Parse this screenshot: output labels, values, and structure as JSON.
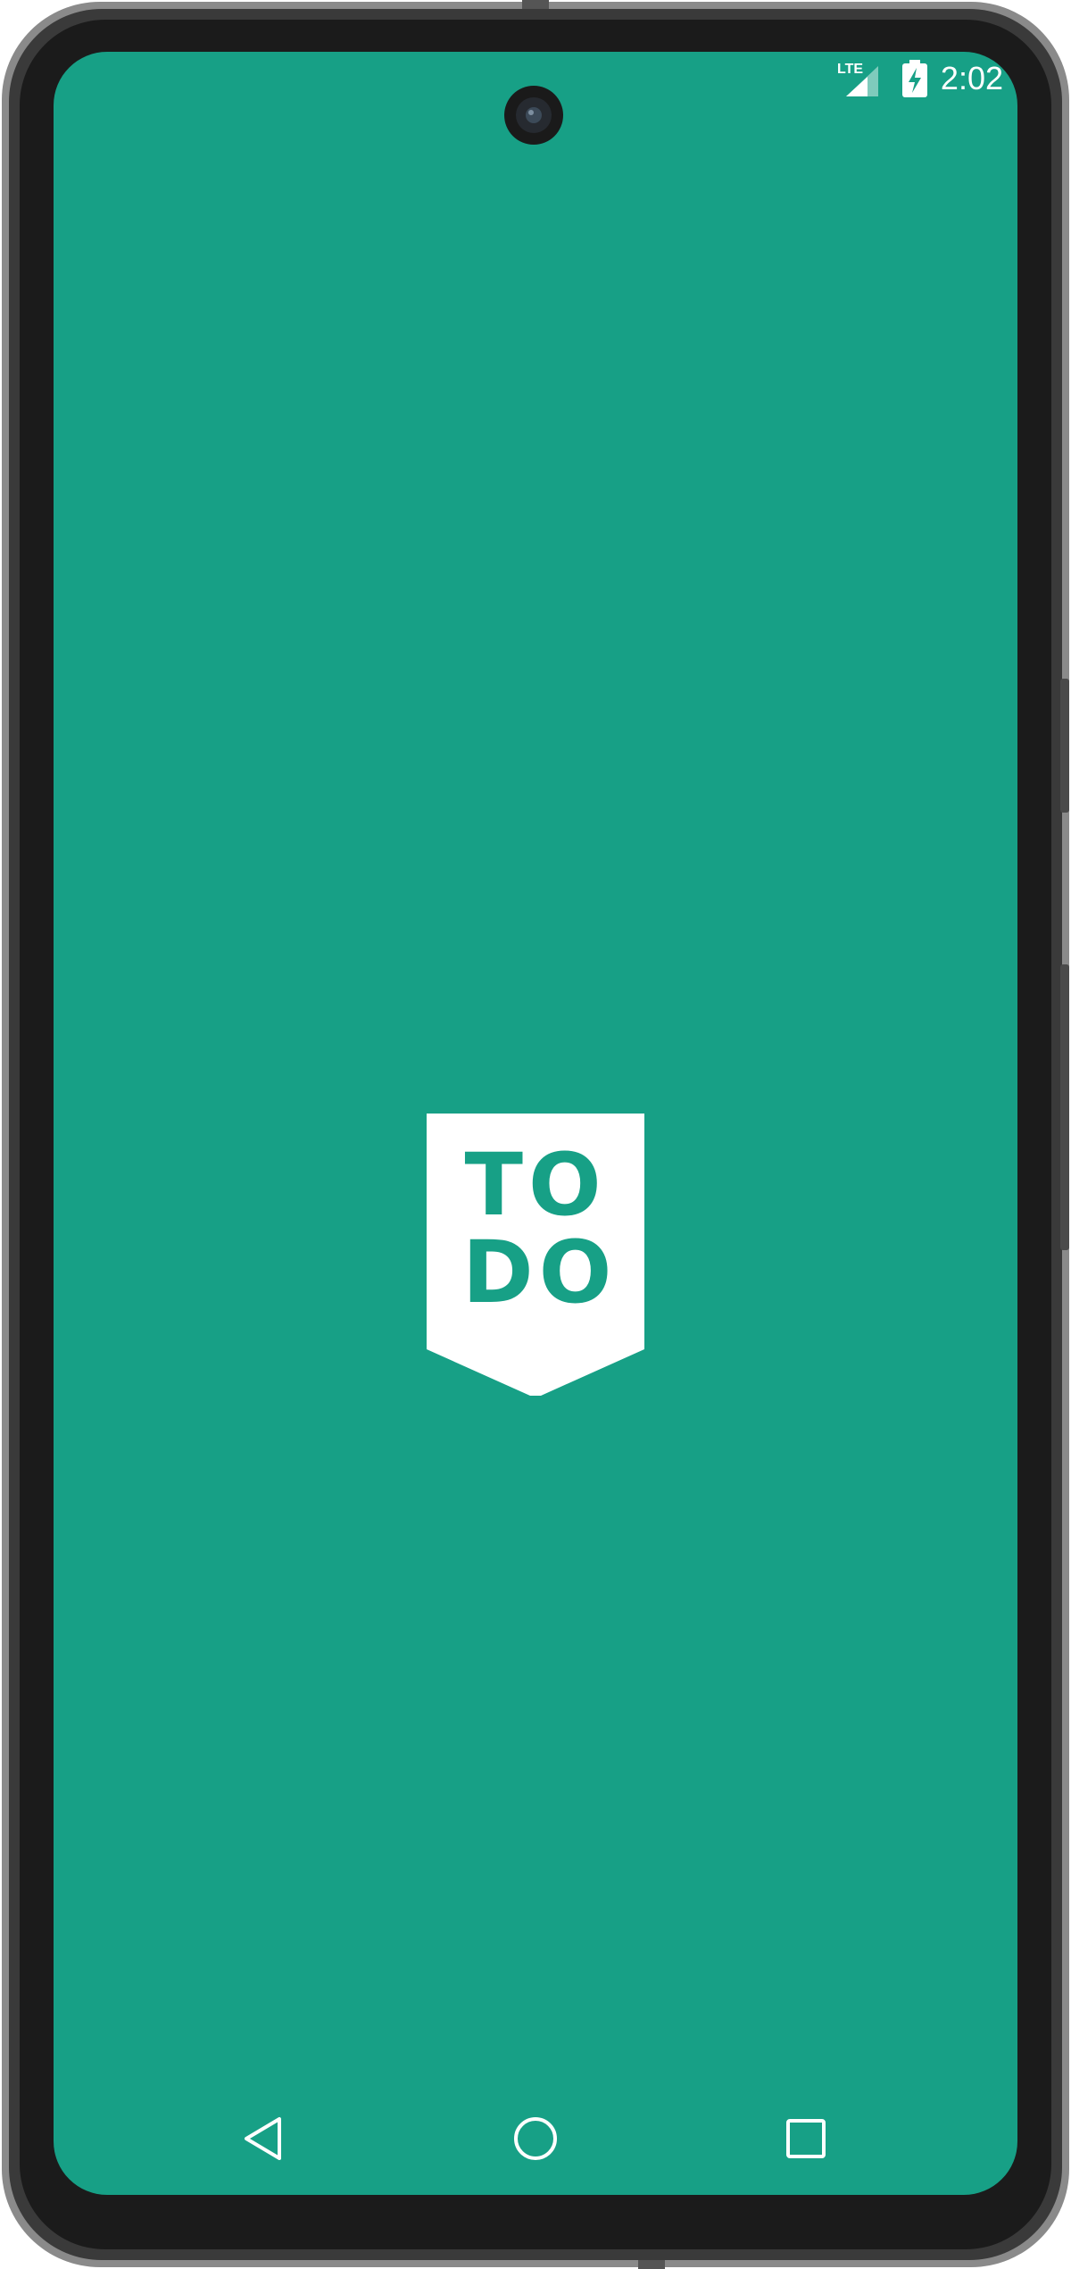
{
  "colors": {
    "screen_background": "#17a086",
    "frame": "#2b2b2b",
    "logo_background": "#ffffff",
    "logo_text": "#17a086",
    "status_text": "#ffffff"
  },
  "status_bar": {
    "network_label": "LTE",
    "time": "2:02",
    "icons": [
      "lte-signal-icon",
      "battery-charging-icon"
    ]
  },
  "splash": {
    "logo_line_1": "TO",
    "logo_line_2": "DO"
  },
  "navigation_bar": {
    "buttons": [
      {
        "name": "back",
        "icon": "triangle-back-icon"
      },
      {
        "name": "home",
        "icon": "circle-home-icon"
      },
      {
        "name": "recents",
        "icon": "square-recents-icon"
      }
    ]
  }
}
